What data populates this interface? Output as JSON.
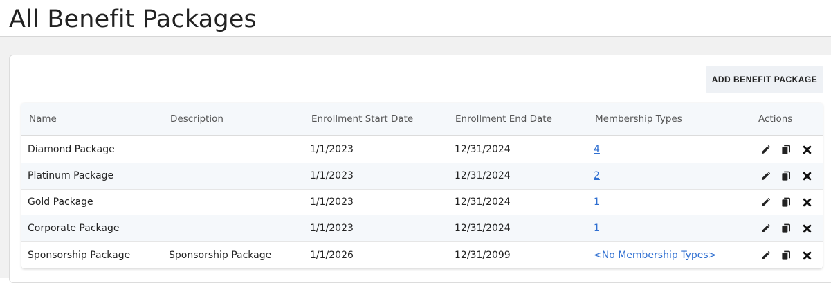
{
  "page": {
    "title": "All Benefit Packages"
  },
  "toolbar": {
    "add_label": "ADD BENEFIT PACKAGE"
  },
  "table": {
    "headers": {
      "name": "Name",
      "description": "Description",
      "start": "Enrollment Start Date",
      "end": "Enrollment End Date",
      "membership": "Membership Types",
      "actions": "Actions"
    },
    "rows": [
      {
        "name": "Diamond Package",
        "description": "",
        "start": "1/1/2023",
        "end": "12/31/2024",
        "membership": "4"
      },
      {
        "name": "Platinum Package",
        "description": "",
        "start": "1/1/2023",
        "end": "12/31/2024",
        "membership": "2"
      },
      {
        "name": "Gold Package",
        "description": "",
        "start": "1/1/2023",
        "end": "12/31/2024",
        "membership": "1"
      },
      {
        "name": "Corporate Package",
        "description": "",
        "start": "1/1/2023",
        "end": "12/31/2024",
        "membership": "1"
      },
      {
        "name": "Sponsorship Package",
        "description": "Sponsorship Package",
        "start": "1/1/2026",
        "end": "12/31/2099",
        "membership": "<No Membership Types>"
      }
    ],
    "row_actions": [
      "edit-icon",
      "copy-icon",
      "delete-icon"
    ]
  },
  "colors": {
    "link": "#2f6fd1",
    "header_bg": "#f5f8fb",
    "button_bg": "#eef1f5",
    "page_bg": "#f1f1f1"
  }
}
